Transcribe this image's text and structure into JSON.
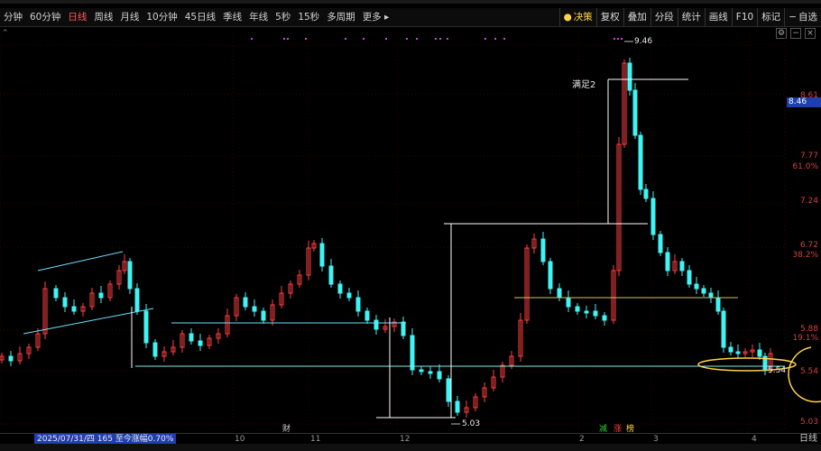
{
  "toolbar": {
    "periods": [
      "分钟",
      "60分钟",
      "日线",
      "周线",
      "月线",
      "10分钟",
      "45日线",
      "季线",
      "年线",
      "5秒",
      "15秒",
      "多周期",
      "更多 ▸"
    ],
    "active_period": "日线",
    "right_buttons": [
      "决策",
      "复权",
      "叠加",
      "分段",
      "统计",
      "画线",
      "F10",
      "标记",
      "自选"
    ]
  },
  "price_tag": "8.46",
  "axis_labels": {
    "values": [
      "8.61",
      "7.77",
      "61.0%",
      "7.24",
      "6.72",
      "38.2%",
      "5.88",
      "19.1%",
      "5.54",
      "5.03"
    ],
    "top": "9.46"
  },
  "annotations": {
    "high": "9.46",
    "low": "5.03",
    "right_low": "5.54",
    "manzu": "满足2"
  },
  "bottom": {
    "date_info": "2025/07/31/四 165 至今涨幅0.70%",
    "months": [
      "10",
      "11",
      "12",
      "2",
      "3",
      "4"
    ],
    "right_label": "日线",
    "icon_cai": "财",
    "icons_right": [
      "减",
      "涨",
      "榜"
    ]
  },
  "colors": {
    "up": "#ff4040",
    "down": "#3ff4f4",
    "gold": "#ffd24a",
    "blue_tag": "#1e3fae"
  }
}
